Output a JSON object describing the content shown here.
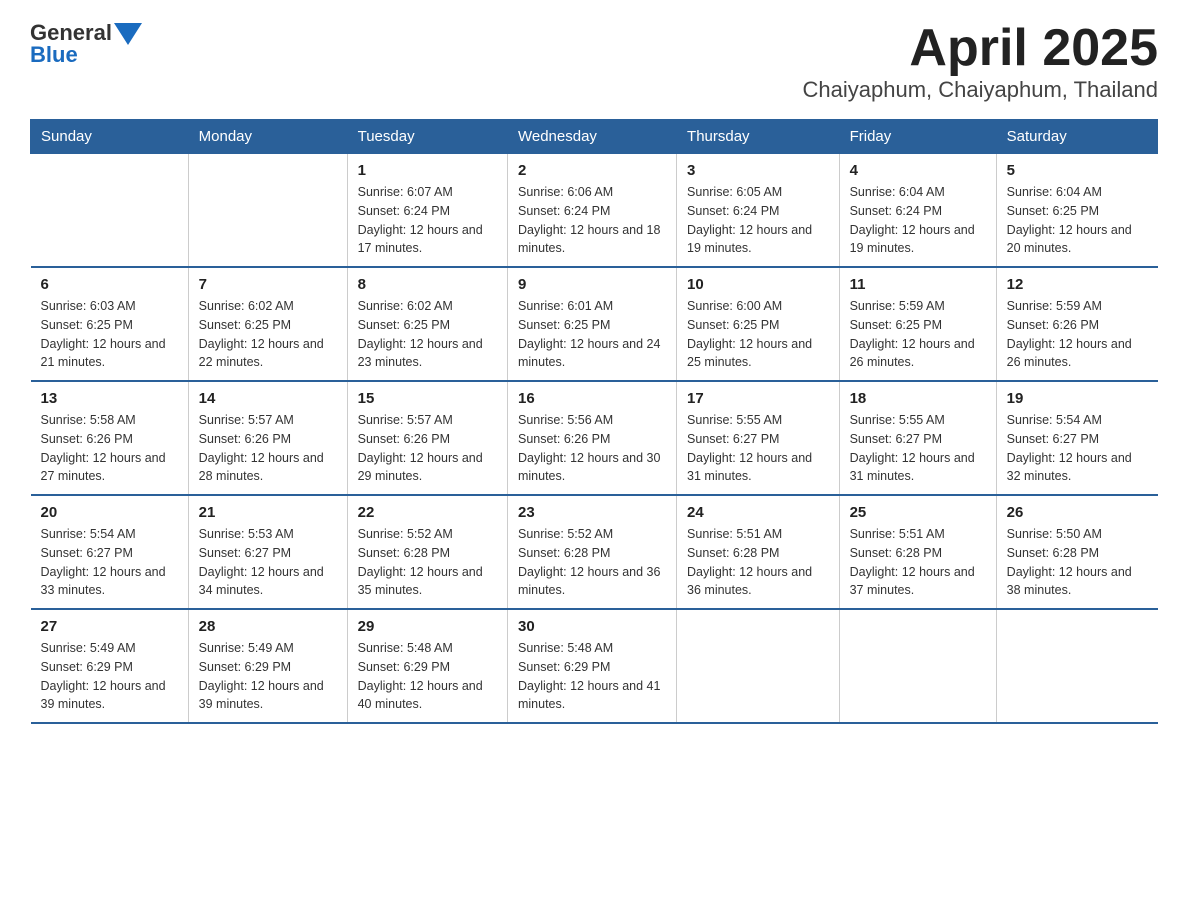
{
  "header": {
    "logo_general": "General",
    "logo_blue": "Blue",
    "title": "April 2025",
    "subtitle": "Chaiyaphum, Chaiyaphum, Thailand"
  },
  "weekdays": [
    "Sunday",
    "Monday",
    "Tuesday",
    "Wednesday",
    "Thursday",
    "Friday",
    "Saturday"
  ],
  "weeks": [
    [
      {
        "day": "",
        "sunrise": "",
        "sunset": "",
        "daylight": ""
      },
      {
        "day": "",
        "sunrise": "",
        "sunset": "",
        "daylight": ""
      },
      {
        "day": "1",
        "sunrise": "Sunrise: 6:07 AM",
        "sunset": "Sunset: 6:24 PM",
        "daylight": "Daylight: 12 hours and 17 minutes."
      },
      {
        "day": "2",
        "sunrise": "Sunrise: 6:06 AM",
        "sunset": "Sunset: 6:24 PM",
        "daylight": "Daylight: 12 hours and 18 minutes."
      },
      {
        "day": "3",
        "sunrise": "Sunrise: 6:05 AM",
        "sunset": "Sunset: 6:24 PM",
        "daylight": "Daylight: 12 hours and 19 minutes."
      },
      {
        "day": "4",
        "sunrise": "Sunrise: 6:04 AM",
        "sunset": "Sunset: 6:24 PM",
        "daylight": "Daylight: 12 hours and 19 minutes."
      },
      {
        "day": "5",
        "sunrise": "Sunrise: 6:04 AM",
        "sunset": "Sunset: 6:25 PM",
        "daylight": "Daylight: 12 hours and 20 minutes."
      }
    ],
    [
      {
        "day": "6",
        "sunrise": "Sunrise: 6:03 AM",
        "sunset": "Sunset: 6:25 PM",
        "daylight": "Daylight: 12 hours and 21 minutes."
      },
      {
        "day": "7",
        "sunrise": "Sunrise: 6:02 AM",
        "sunset": "Sunset: 6:25 PM",
        "daylight": "Daylight: 12 hours and 22 minutes."
      },
      {
        "day": "8",
        "sunrise": "Sunrise: 6:02 AM",
        "sunset": "Sunset: 6:25 PM",
        "daylight": "Daylight: 12 hours and 23 minutes."
      },
      {
        "day": "9",
        "sunrise": "Sunrise: 6:01 AM",
        "sunset": "Sunset: 6:25 PM",
        "daylight": "Daylight: 12 hours and 24 minutes."
      },
      {
        "day": "10",
        "sunrise": "Sunrise: 6:00 AM",
        "sunset": "Sunset: 6:25 PM",
        "daylight": "Daylight: 12 hours and 25 minutes."
      },
      {
        "day": "11",
        "sunrise": "Sunrise: 5:59 AM",
        "sunset": "Sunset: 6:25 PM",
        "daylight": "Daylight: 12 hours and 26 minutes."
      },
      {
        "day": "12",
        "sunrise": "Sunrise: 5:59 AM",
        "sunset": "Sunset: 6:26 PM",
        "daylight": "Daylight: 12 hours and 26 minutes."
      }
    ],
    [
      {
        "day": "13",
        "sunrise": "Sunrise: 5:58 AM",
        "sunset": "Sunset: 6:26 PM",
        "daylight": "Daylight: 12 hours and 27 minutes."
      },
      {
        "day": "14",
        "sunrise": "Sunrise: 5:57 AM",
        "sunset": "Sunset: 6:26 PM",
        "daylight": "Daylight: 12 hours and 28 minutes."
      },
      {
        "day": "15",
        "sunrise": "Sunrise: 5:57 AM",
        "sunset": "Sunset: 6:26 PM",
        "daylight": "Daylight: 12 hours and 29 minutes."
      },
      {
        "day": "16",
        "sunrise": "Sunrise: 5:56 AM",
        "sunset": "Sunset: 6:26 PM",
        "daylight": "Daylight: 12 hours and 30 minutes."
      },
      {
        "day": "17",
        "sunrise": "Sunrise: 5:55 AM",
        "sunset": "Sunset: 6:27 PM",
        "daylight": "Daylight: 12 hours and 31 minutes."
      },
      {
        "day": "18",
        "sunrise": "Sunrise: 5:55 AM",
        "sunset": "Sunset: 6:27 PM",
        "daylight": "Daylight: 12 hours and 31 minutes."
      },
      {
        "day": "19",
        "sunrise": "Sunrise: 5:54 AM",
        "sunset": "Sunset: 6:27 PM",
        "daylight": "Daylight: 12 hours and 32 minutes."
      }
    ],
    [
      {
        "day": "20",
        "sunrise": "Sunrise: 5:54 AM",
        "sunset": "Sunset: 6:27 PM",
        "daylight": "Daylight: 12 hours and 33 minutes."
      },
      {
        "day": "21",
        "sunrise": "Sunrise: 5:53 AM",
        "sunset": "Sunset: 6:27 PM",
        "daylight": "Daylight: 12 hours and 34 minutes."
      },
      {
        "day": "22",
        "sunrise": "Sunrise: 5:52 AM",
        "sunset": "Sunset: 6:28 PM",
        "daylight": "Daylight: 12 hours and 35 minutes."
      },
      {
        "day": "23",
        "sunrise": "Sunrise: 5:52 AM",
        "sunset": "Sunset: 6:28 PM",
        "daylight": "Daylight: 12 hours and 36 minutes."
      },
      {
        "day": "24",
        "sunrise": "Sunrise: 5:51 AM",
        "sunset": "Sunset: 6:28 PM",
        "daylight": "Daylight: 12 hours and 36 minutes."
      },
      {
        "day": "25",
        "sunrise": "Sunrise: 5:51 AM",
        "sunset": "Sunset: 6:28 PM",
        "daylight": "Daylight: 12 hours and 37 minutes."
      },
      {
        "day": "26",
        "sunrise": "Sunrise: 5:50 AM",
        "sunset": "Sunset: 6:28 PM",
        "daylight": "Daylight: 12 hours and 38 minutes."
      }
    ],
    [
      {
        "day": "27",
        "sunrise": "Sunrise: 5:49 AM",
        "sunset": "Sunset: 6:29 PM",
        "daylight": "Daylight: 12 hours and 39 minutes."
      },
      {
        "day": "28",
        "sunrise": "Sunrise: 5:49 AM",
        "sunset": "Sunset: 6:29 PM",
        "daylight": "Daylight: 12 hours and 39 minutes."
      },
      {
        "day": "29",
        "sunrise": "Sunrise: 5:48 AM",
        "sunset": "Sunset: 6:29 PM",
        "daylight": "Daylight: 12 hours and 40 minutes."
      },
      {
        "day": "30",
        "sunrise": "Sunrise: 5:48 AM",
        "sunset": "Sunset: 6:29 PM",
        "daylight": "Daylight: 12 hours and 41 minutes."
      },
      {
        "day": "",
        "sunrise": "",
        "sunset": "",
        "daylight": ""
      },
      {
        "day": "",
        "sunrise": "",
        "sunset": "",
        "daylight": ""
      },
      {
        "day": "",
        "sunrise": "",
        "sunset": "",
        "daylight": ""
      }
    ]
  ]
}
